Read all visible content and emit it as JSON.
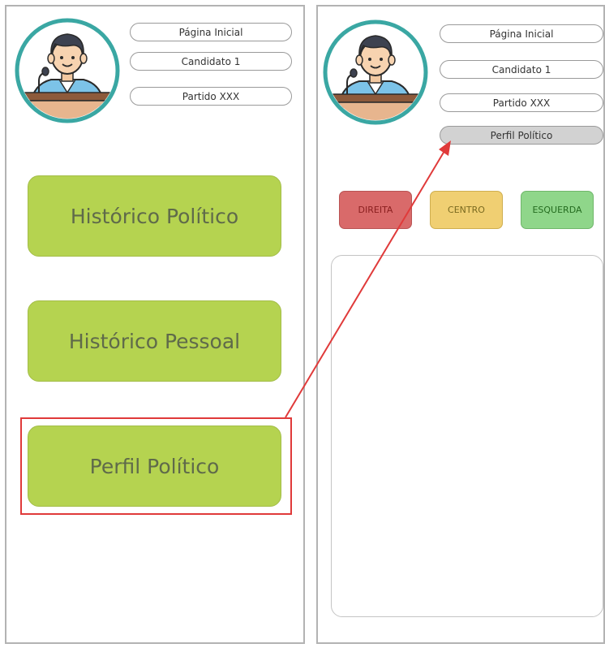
{
  "left_screen": {
    "nav": [
      "Página Inicial",
      "Candidato 1",
      "Partido XXX"
    ],
    "buttons": [
      "Histórico Político",
      "Histórico Pessoal",
      "Perfil Político"
    ]
  },
  "right_screen": {
    "nav": [
      "Página Inicial",
      "Candidato 1",
      "Partido XXX",
      "Perfil Político"
    ],
    "ideology": [
      {
        "label": "DIREITA",
        "color": "#d96a6a",
        "text_color": "#8a1f1f"
      },
      {
        "label": "CENTRO",
        "color": "#f0cf72",
        "text_color": "#7a6a20"
      },
      {
        "label": "ESQUERDA",
        "color": "#8fd68a",
        "text_color": "#246b1f"
      }
    ]
  },
  "colors": {
    "button_green": "#b5d350",
    "highlight_red": "#e03a3a",
    "avatar_ring": "#3aa7a3"
  },
  "icons": [
    "candidate-avatar-icon",
    "arrow-annotation"
  ]
}
